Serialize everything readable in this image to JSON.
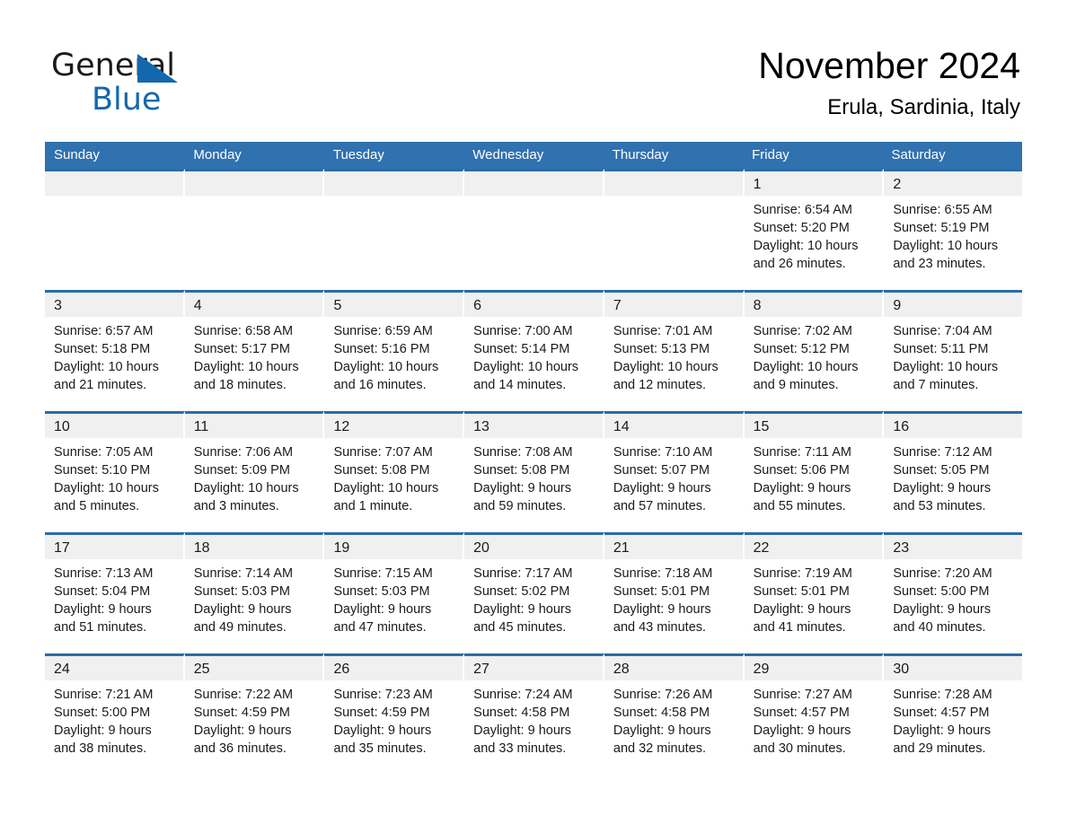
{
  "logo": {
    "word_one": "General",
    "word_two": "Blue",
    "triangle_color": "#1368ad"
  },
  "header": {
    "title": "November 2024",
    "subtitle": "Erula, Sardinia, Italy"
  },
  "theme": {
    "header_bar": "#3071b0",
    "row_divider": "#2b6ca8",
    "daynum_band": "#f0f0f0",
    "text": "#1a1a1a"
  },
  "weekday_headers": [
    "Sunday",
    "Monday",
    "Tuesday",
    "Wednesday",
    "Thursday",
    "Friday",
    "Saturday"
  ],
  "weeks": [
    [
      {
        "day": "",
        "sunrise": "",
        "sunset": "",
        "daylight_1": "",
        "daylight_2": ""
      },
      {
        "day": "",
        "sunrise": "",
        "sunset": "",
        "daylight_1": "",
        "daylight_2": ""
      },
      {
        "day": "",
        "sunrise": "",
        "sunset": "",
        "daylight_1": "",
        "daylight_2": ""
      },
      {
        "day": "",
        "sunrise": "",
        "sunset": "",
        "daylight_1": "",
        "daylight_2": ""
      },
      {
        "day": "",
        "sunrise": "",
        "sunset": "",
        "daylight_1": "",
        "daylight_2": ""
      },
      {
        "day": "1",
        "sunrise": "Sunrise: 6:54 AM",
        "sunset": "Sunset: 5:20 PM",
        "daylight_1": "Daylight: 10 hours",
        "daylight_2": "and 26 minutes."
      },
      {
        "day": "2",
        "sunrise": "Sunrise: 6:55 AM",
        "sunset": "Sunset: 5:19 PM",
        "daylight_1": "Daylight: 10 hours",
        "daylight_2": "and 23 minutes."
      }
    ],
    [
      {
        "day": "3",
        "sunrise": "Sunrise: 6:57 AM",
        "sunset": "Sunset: 5:18 PM",
        "daylight_1": "Daylight: 10 hours",
        "daylight_2": "and 21 minutes."
      },
      {
        "day": "4",
        "sunrise": "Sunrise: 6:58 AM",
        "sunset": "Sunset: 5:17 PM",
        "daylight_1": "Daylight: 10 hours",
        "daylight_2": "and 18 minutes."
      },
      {
        "day": "5",
        "sunrise": "Sunrise: 6:59 AM",
        "sunset": "Sunset: 5:16 PM",
        "daylight_1": "Daylight: 10 hours",
        "daylight_2": "and 16 minutes."
      },
      {
        "day": "6",
        "sunrise": "Sunrise: 7:00 AM",
        "sunset": "Sunset: 5:14 PM",
        "daylight_1": "Daylight: 10 hours",
        "daylight_2": "and 14 minutes."
      },
      {
        "day": "7",
        "sunrise": "Sunrise: 7:01 AM",
        "sunset": "Sunset: 5:13 PM",
        "daylight_1": "Daylight: 10 hours",
        "daylight_2": "and 12 minutes."
      },
      {
        "day": "8",
        "sunrise": "Sunrise: 7:02 AM",
        "sunset": "Sunset: 5:12 PM",
        "daylight_1": "Daylight: 10 hours",
        "daylight_2": "and 9 minutes."
      },
      {
        "day": "9",
        "sunrise": "Sunrise: 7:04 AM",
        "sunset": "Sunset: 5:11 PM",
        "daylight_1": "Daylight: 10 hours",
        "daylight_2": "and 7 minutes."
      }
    ],
    [
      {
        "day": "10",
        "sunrise": "Sunrise: 7:05 AM",
        "sunset": "Sunset: 5:10 PM",
        "daylight_1": "Daylight: 10 hours",
        "daylight_2": "and 5 minutes."
      },
      {
        "day": "11",
        "sunrise": "Sunrise: 7:06 AM",
        "sunset": "Sunset: 5:09 PM",
        "daylight_1": "Daylight: 10 hours",
        "daylight_2": "and 3 minutes."
      },
      {
        "day": "12",
        "sunrise": "Sunrise: 7:07 AM",
        "sunset": "Sunset: 5:08 PM",
        "daylight_1": "Daylight: 10 hours",
        "daylight_2": "and 1 minute."
      },
      {
        "day": "13",
        "sunrise": "Sunrise: 7:08 AM",
        "sunset": "Sunset: 5:08 PM",
        "daylight_1": "Daylight: 9 hours",
        "daylight_2": "and 59 minutes."
      },
      {
        "day": "14",
        "sunrise": "Sunrise: 7:10 AM",
        "sunset": "Sunset: 5:07 PM",
        "daylight_1": "Daylight: 9 hours",
        "daylight_2": "and 57 minutes."
      },
      {
        "day": "15",
        "sunrise": "Sunrise: 7:11 AM",
        "sunset": "Sunset: 5:06 PM",
        "daylight_1": "Daylight: 9 hours",
        "daylight_2": "and 55 minutes."
      },
      {
        "day": "16",
        "sunrise": "Sunrise: 7:12 AM",
        "sunset": "Sunset: 5:05 PM",
        "daylight_1": "Daylight: 9 hours",
        "daylight_2": "and 53 minutes."
      }
    ],
    [
      {
        "day": "17",
        "sunrise": "Sunrise: 7:13 AM",
        "sunset": "Sunset: 5:04 PM",
        "daylight_1": "Daylight: 9 hours",
        "daylight_2": "and 51 minutes."
      },
      {
        "day": "18",
        "sunrise": "Sunrise: 7:14 AM",
        "sunset": "Sunset: 5:03 PM",
        "daylight_1": "Daylight: 9 hours",
        "daylight_2": "and 49 minutes."
      },
      {
        "day": "19",
        "sunrise": "Sunrise: 7:15 AM",
        "sunset": "Sunset: 5:03 PM",
        "daylight_1": "Daylight: 9 hours",
        "daylight_2": "and 47 minutes."
      },
      {
        "day": "20",
        "sunrise": "Sunrise: 7:17 AM",
        "sunset": "Sunset: 5:02 PM",
        "daylight_1": "Daylight: 9 hours",
        "daylight_2": "and 45 minutes."
      },
      {
        "day": "21",
        "sunrise": "Sunrise: 7:18 AM",
        "sunset": "Sunset: 5:01 PM",
        "daylight_1": "Daylight: 9 hours",
        "daylight_2": "and 43 minutes."
      },
      {
        "day": "22",
        "sunrise": "Sunrise: 7:19 AM",
        "sunset": "Sunset: 5:01 PM",
        "daylight_1": "Daylight: 9 hours",
        "daylight_2": "and 41 minutes."
      },
      {
        "day": "23",
        "sunrise": "Sunrise: 7:20 AM",
        "sunset": "Sunset: 5:00 PM",
        "daylight_1": "Daylight: 9 hours",
        "daylight_2": "and 40 minutes."
      }
    ],
    [
      {
        "day": "24",
        "sunrise": "Sunrise: 7:21 AM",
        "sunset": "Sunset: 5:00 PM",
        "daylight_1": "Daylight: 9 hours",
        "daylight_2": "and 38 minutes."
      },
      {
        "day": "25",
        "sunrise": "Sunrise: 7:22 AM",
        "sunset": "Sunset: 4:59 PM",
        "daylight_1": "Daylight: 9 hours",
        "daylight_2": "and 36 minutes."
      },
      {
        "day": "26",
        "sunrise": "Sunrise: 7:23 AM",
        "sunset": "Sunset: 4:59 PM",
        "daylight_1": "Daylight: 9 hours",
        "daylight_2": "and 35 minutes."
      },
      {
        "day": "27",
        "sunrise": "Sunrise: 7:24 AM",
        "sunset": "Sunset: 4:58 PM",
        "daylight_1": "Daylight: 9 hours",
        "daylight_2": "and 33 minutes."
      },
      {
        "day": "28",
        "sunrise": "Sunrise: 7:26 AM",
        "sunset": "Sunset: 4:58 PM",
        "daylight_1": "Daylight: 9 hours",
        "daylight_2": "and 32 minutes."
      },
      {
        "day": "29",
        "sunrise": "Sunrise: 7:27 AM",
        "sunset": "Sunset: 4:57 PM",
        "daylight_1": "Daylight: 9 hours",
        "daylight_2": "and 30 minutes."
      },
      {
        "day": "30",
        "sunrise": "Sunrise: 7:28 AM",
        "sunset": "Sunset: 4:57 PM",
        "daylight_1": "Daylight: 9 hours",
        "daylight_2": "and 29 minutes."
      }
    ]
  ]
}
